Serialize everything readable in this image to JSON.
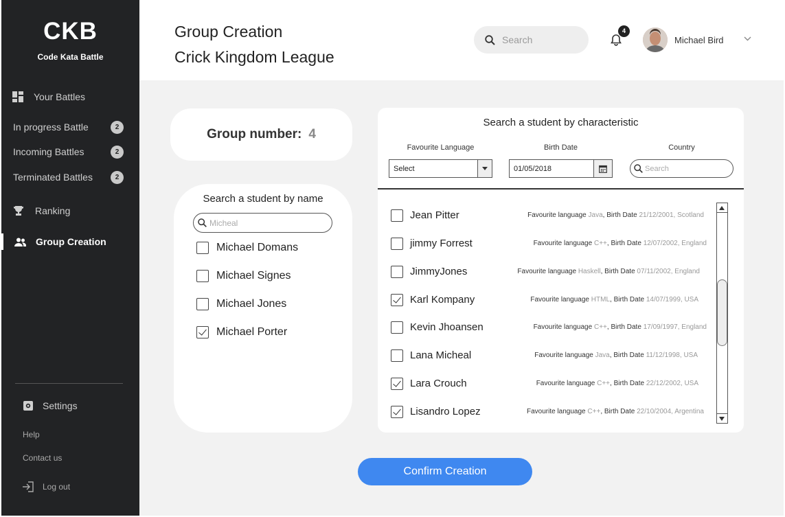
{
  "sidebar": {
    "logo": "CKB",
    "logo_sub": "Code Kata Battle",
    "your_battles": "Your Battles",
    "in_progress": "In progress Battle",
    "in_progress_count": "2",
    "incoming": "Incoming Battles",
    "incoming_count": "2",
    "terminated": "Terminated Battles",
    "terminated_count": "2",
    "ranking": "Ranking",
    "group_creation": "Group Creation",
    "settings": "Settings",
    "help": "Help",
    "contact": "Contact us",
    "logout": "Log out"
  },
  "header": {
    "title": "Group Creation",
    "subtitle": "Crick Kingdom League",
    "search_placeholder": "Search",
    "notification_count": "4",
    "user_name": "Michael Bird"
  },
  "group": {
    "label": "Group number:",
    "number": "4"
  },
  "name_search": {
    "title": "Search a student by name",
    "query": "Micheal",
    "results": [
      {
        "name": "Michael Domans",
        "checked": false
      },
      {
        "name": "Michael Signes",
        "checked": false
      },
      {
        "name": "Michael Jones",
        "checked": false
      },
      {
        "name": "Michael Porter",
        "checked": true
      }
    ]
  },
  "char_search": {
    "title": "Search a student by characteristic",
    "lang_label": "Favourite Language",
    "lang_value": "Select",
    "birth_label": "Birth Date",
    "birth_value": "01/05/2018",
    "country_label": "Country",
    "country_placeholder": "Search",
    "students": [
      {
        "name": "Jean Pitter",
        "checked": false,
        "lang_prefix": "Favourite language",
        "lang": "Java",
        "birth_prefix": "Birth Date",
        "birth": "21/12/2001,",
        "country": "Scotland"
      },
      {
        "name": "jimmy Forrest",
        "checked": false,
        "lang_prefix": "Favourite language",
        "lang": "C++",
        "birth_prefix": "Birth Date",
        "birth": "12/07/2002,",
        "country": "England"
      },
      {
        "name": "JimmyJones",
        "checked": false,
        "lang_prefix": "Favourite language",
        "lang": "Haskell",
        "birth_prefix": "Birth Date",
        "birth": "07/11/2002,",
        "country": "England"
      },
      {
        "name": "Karl Kompany",
        "checked": true,
        "lang_prefix": "Favourite language",
        "lang": "HTML",
        "birth_prefix": "Birth Date",
        "birth": "14/07/1999,",
        "country": "USA"
      },
      {
        "name": "Kevin Jhoansen",
        "checked": false,
        "lang_prefix": "Favourite language",
        "lang": "C++",
        "birth_prefix": "Birth Date",
        "birth": "17/09/1997,",
        "country": "England"
      },
      {
        "name": "Lana Micheal",
        "checked": false,
        "lang_prefix": "Favourite language",
        "lang": "Java",
        "birth_prefix": "Birth Date",
        "birth": "11/12/1998,",
        "country": "USA"
      },
      {
        "name": "Lara Crouch",
        "checked": true,
        "lang_prefix": "Favourite language",
        "lang": "C++",
        "birth_prefix": "Birth Date",
        "birth": "22/12/2002,",
        "country": "USA"
      },
      {
        "name": "Lisandro Lopez",
        "checked": true,
        "lang_prefix": "Favourite language",
        "lang": "C++",
        "birth_prefix": "Birth Date",
        "birth": "22/10/2004,",
        "country": "Argentina"
      }
    ]
  },
  "confirm_label": "Confirm Creation"
}
